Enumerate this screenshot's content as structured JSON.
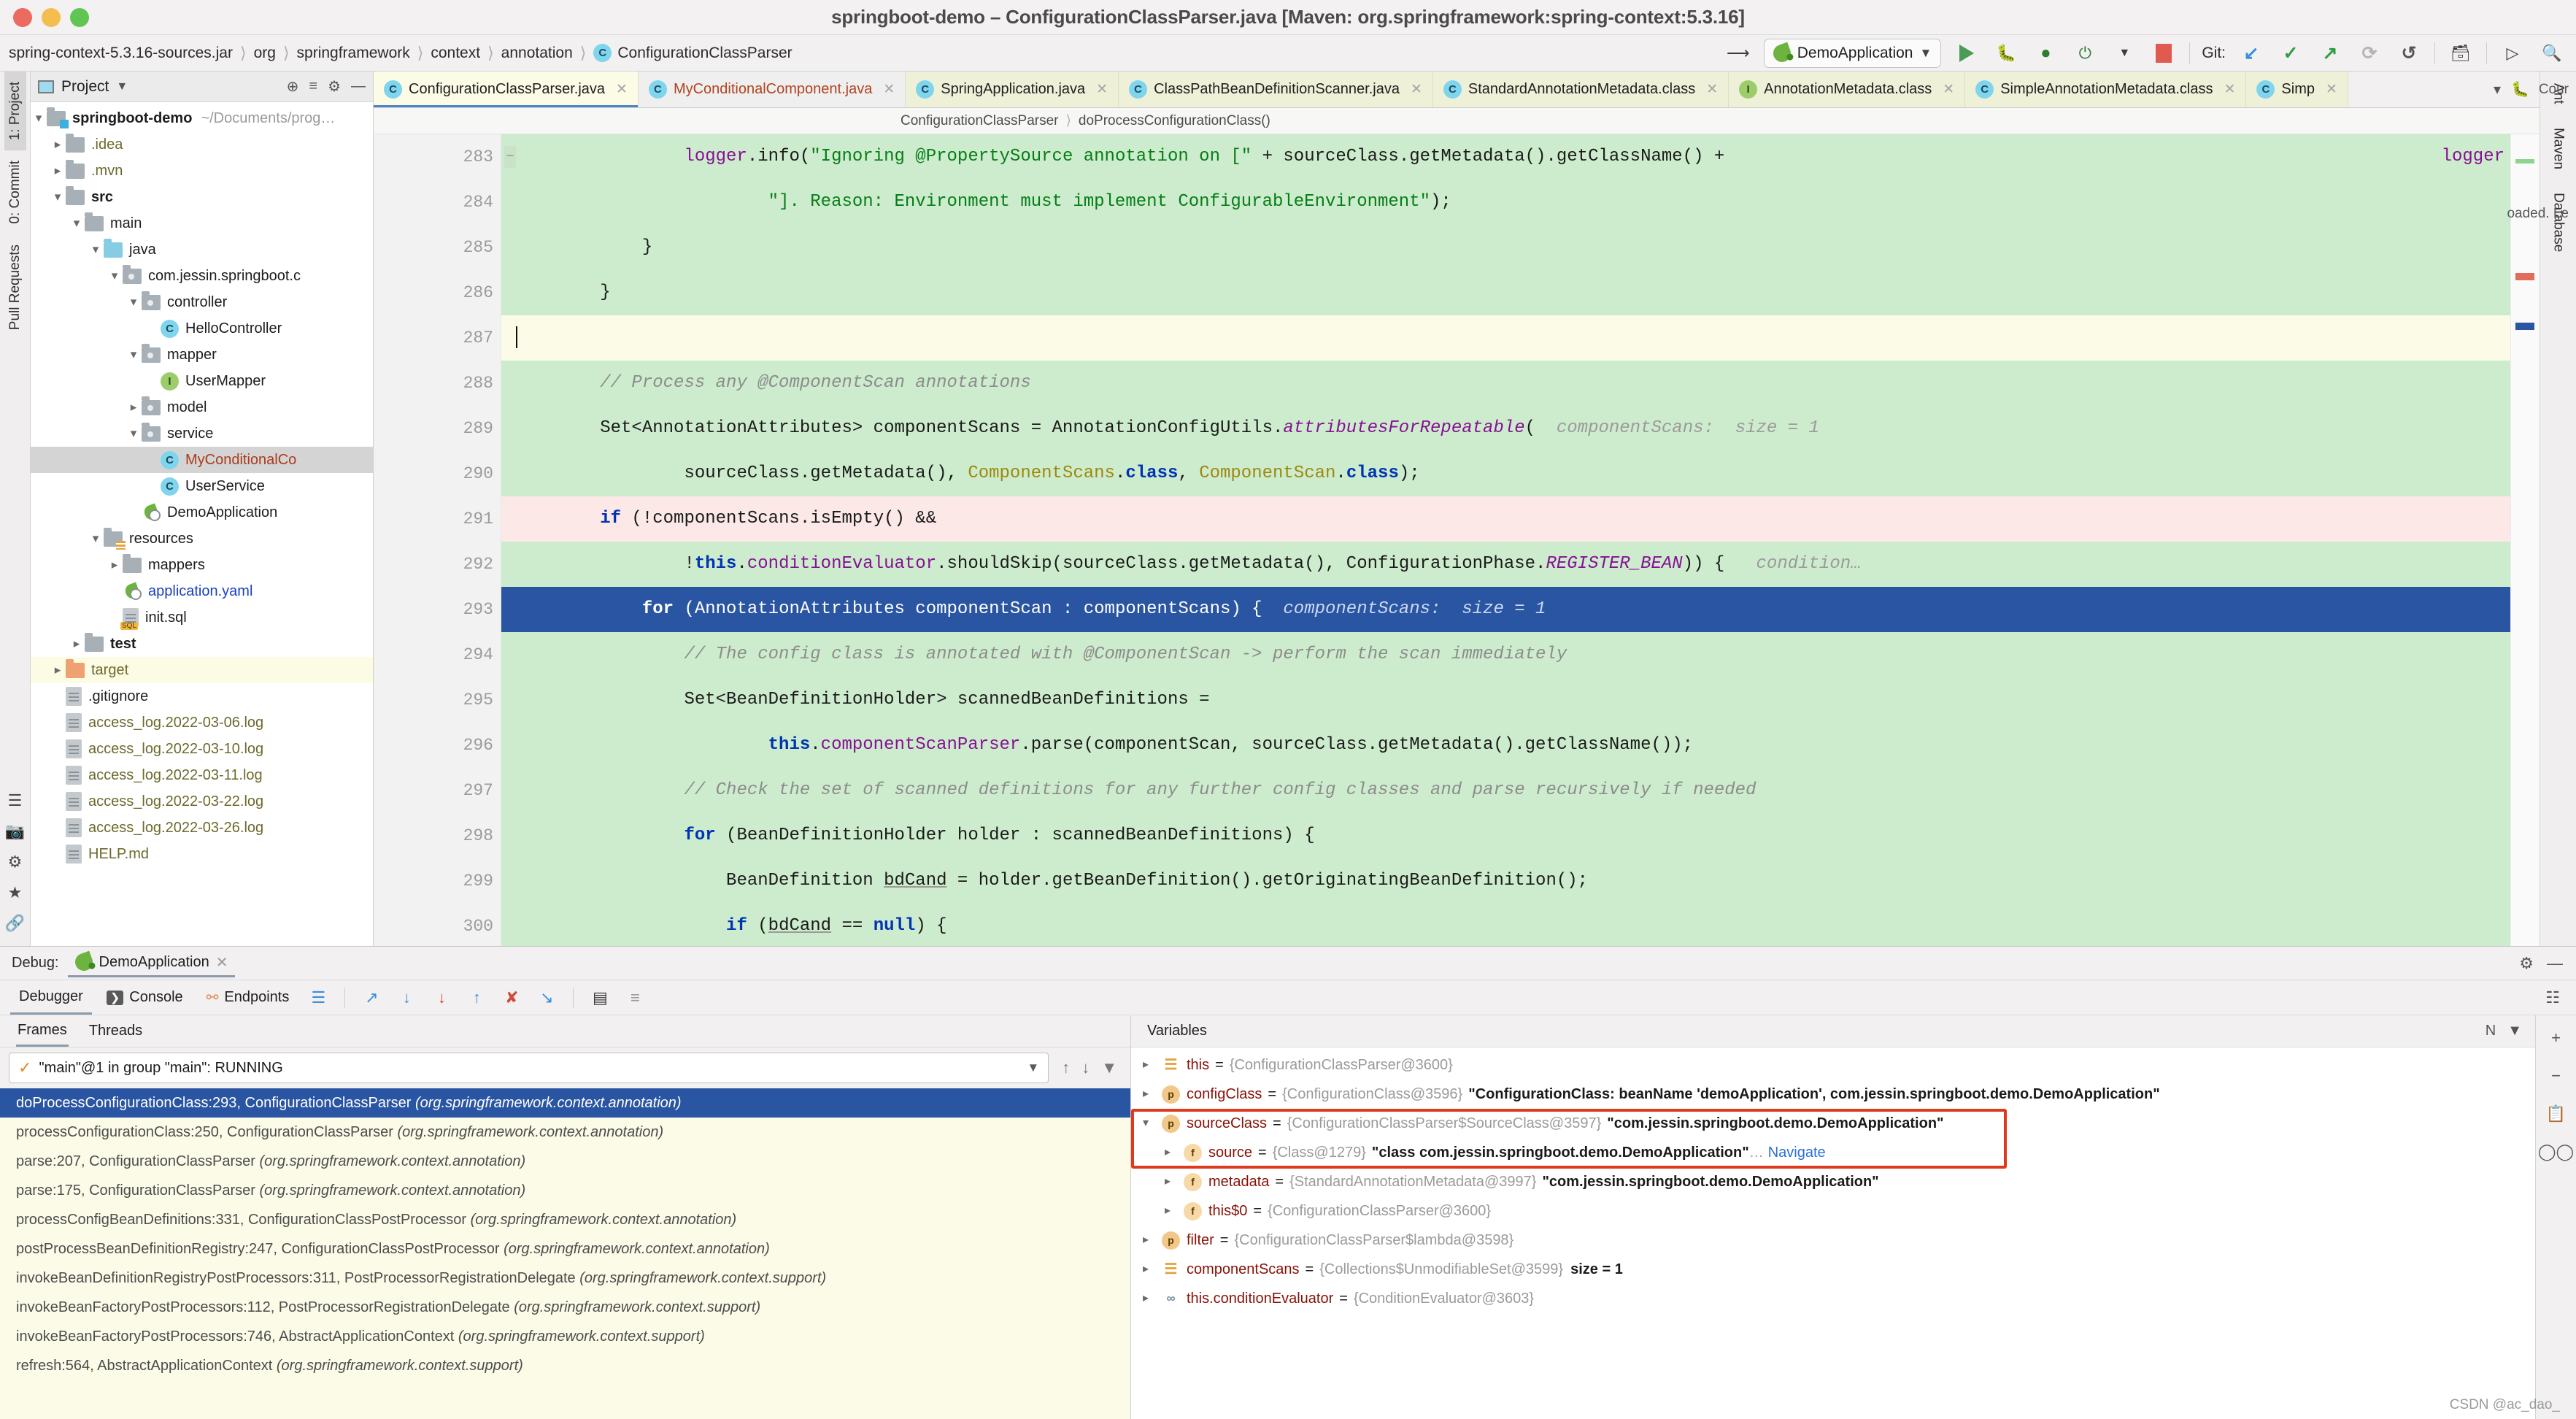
{
  "window": {
    "title": "springboot-demo – ConfigurationClassParser.java [Maven: org.springframework:spring-context:5.3.16]"
  },
  "breadcrumb": {
    "items": [
      "spring-context-5.3.16-sources.jar",
      "org",
      "springframework",
      "context",
      "annotation"
    ],
    "class_icon": "C",
    "class_name": "ConfigurationClassParser"
  },
  "toolbar": {
    "back_icon": "back-arrow-icon",
    "run_config": "DemoApplication",
    "run_icon": "run-icon",
    "debug_icon": "debug-icon",
    "run_coverage_icon": "run-with-coverage-icon",
    "profile_icon": "profile-icon",
    "stop_icon": "stop-icon",
    "git_label": "Git:",
    "git_update": "↙",
    "git_commit": "✓",
    "git_push": "↗",
    "git_history": "⟳",
    "git_rollback": "↺",
    "structure_icon": "project-structure-icon",
    "terminal_icon": "terminal-icon",
    "search_icon": "search-everywhere-icon"
  },
  "left_strip": {
    "tabs": [
      "1: Project",
      "0: Commit",
      "Pull Requests"
    ],
    "bottom": [
      "7: Structure",
      "2: Favorites",
      "Web"
    ]
  },
  "right_strip": {
    "tabs": [
      "Ant",
      "Maven",
      "Database"
    ]
  },
  "project_panel": {
    "title": "Project",
    "locate_icon": "locate-icon",
    "collapse_icon": "collapse-all-icon",
    "settings_icon": "gear-icon",
    "hide_icon": "hide-icon",
    "tree": [
      {
        "depth": 0,
        "arrow": "v",
        "icon": "folder-module",
        "label": "springboot-demo",
        "style": "bold",
        "path": "~/Documents/prog…"
      },
      {
        "depth": 1,
        "arrow": ">",
        "icon": "folder",
        "label": ".idea",
        "style": "olive"
      },
      {
        "depth": 1,
        "arrow": ">",
        "icon": "folder",
        "label": ".mvn",
        "style": "olive"
      },
      {
        "depth": 1,
        "arrow": "v",
        "icon": "folder",
        "label": "src",
        "style": "bold"
      },
      {
        "depth": 2,
        "arrow": "v",
        "icon": "folder",
        "label": "main"
      },
      {
        "depth": 3,
        "arrow": "v",
        "icon": "folder-src",
        "label": "java"
      },
      {
        "depth": 4,
        "arrow": "v",
        "icon": "folder-pkg",
        "label": "com.jessin.springboot.c"
      },
      {
        "depth": 5,
        "arrow": "v",
        "icon": "folder-pkg",
        "label": "controller"
      },
      {
        "depth": 6,
        "arrow": "",
        "icon": "class",
        "label": "HelloController"
      },
      {
        "depth": 5,
        "arrow": "v",
        "icon": "folder-pkg",
        "label": "mapper"
      },
      {
        "depth": 6,
        "arrow": "",
        "icon": "interface",
        "label": "UserMapper"
      },
      {
        "depth": 5,
        "arrow": ">",
        "icon": "folder-pkg",
        "label": "model"
      },
      {
        "depth": 5,
        "arrow": "v",
        "icon": "folder-pkg",
        "label": "service"
      },
      {
        "depth": 6,
        "arrow": "",
        "icon": "class",
        "label": "MyConditionalCo",
        "style": "red",
        "row": "sel"
      },
      {
        "depth": 6,
        "arrow": "",
        "icon": "class",
        "label": "UserService"
      },
      {
        "depth": 5,
        "arrow": "",
        "icon": "spring",
        "label": "DemoApplication"
      },
      {
        "depth": 3,
        "arrow": "v",
        "icon": "folder-res",
        "label": "resources"
      },
      {
        "depth": 4,
        "arrow": ">",
        "icon": "folder",
        "label": "mappers"
      },
      {
        "depth": 4,
        "arrow": "",
        "icon": "spring-yaml",
        "label": "application.yaml",
        "style": "blue"
      },
      {
        "depth": 4,
        "arrow": "",
        "icon": "sql",
        "label": "init.sql"
      },
      {
        "depth": 2,
        "arrow": ">",
        "icon": "folder",
        "label": "test",
        "style": "bold"
      },
      {
        "depth": 1,
        "arrow": ">",
        "icon": "folder-target",
        "label": "target",
        "style": "olive",
        "row": "hl"
      },
      {
        "depth": 1,
        "arrow": "",
        "icon": "gitignore",
        "label": ".gitignore"
      },
      {
        "depth": 1,
        "arrow": "",
        "icon": "doc",
        "label": "access_log.2022-03-06.log",
        "style": "olive"
      },
      {
        "depth": 1,
        "arrow": "",
        "icon": "doc",
        "label": "access_log.2022-03-10.log",
        "style": "olive"
      },
      {
        "depth": 1,
        "arrow": "",
        "icon": "doc",
        "label": "access_log.2022-03-11.log",
        "style": "olive"
      },
      {
        "depth": 1,
        "arrow": "",
        "icon": "doc",
        "label": "access_log.2022-03-22.log",
        "style": "olive"
      },
      {
        "depth": 1,
        "arrow": "",
        "icon": "doc",
        "label": "access_log.2022-03-26.log",
        "style": "olive"
      },
      {
        "depth": 1,
        "arrow": "",
        "icon": "doc",
        "label": "HELP.md",
        "style": "olive"
      }
    ]
  },
  "editor_tabs": [
    {
      "label": "ConfigurationClassParser.java",
      "icon": "C",
      "state": "active"
    },
    {
      "label": "MyConditionalComponent.java",
      "icon": "C",
      "state": "modified",
      "color": "red"
    },
    {
      "label": "SpringApplication.java",
      "icon": "C",
      "state": "normal",
      "spring": true
    },
    {
      "label": "ClassPathBeanDefinitionScanner.java",
      "icon": "C",
      "state": "normal"
    },
    {
      "label": "StandardAnnotationMetadata.class",
      "icon": "C",
      "state": "normal"
    },
    {
      "label": "AnnotationMetadata.class",
      "icon": "I",
      "state": "normal"
    },
    {
      "label": "SimpleAnnotationMetadata.class",
      "icon": "C",
      "state": "normal"
    },
    {
      "label": "Simp",
      "icon": "C",
      "state": "normal"
    }
  ],
  "editor_breadcrumb": {
    "class": "ConfigurationClassParser",
    "sep": "›",
    "method": "doProcessConfigurationClass()"
  },
  "code": {
    "lines": [
      {
        "n": "283",
        "bg": "add",
        "html": "                <span class=\"fld\">logger</span>.info(<span class=\"str\">\"Ignoring @PropertySource annotation on [\"</span> + sourceClass.getMetadata().getClassName() +"
      },
      {
        "n": "284",
        "bg": "add",
        "html": "                        <span class=\"str\">\"]. Reason: Environment must implement ConfigurableEnvironment\"</span>);"
      },
      {
        "n": "285",
        "bg": "add",
        "html": "            }"
      },
      {
        "n": "286",
        "bg": "add",
        "html": "        }"
      },
      {
        "n": "287",
        "bg": "caret",
        "html": "<span class=\"caret-bar\"></span>"
      },
      {
        "n": "288",
        "bg": "add",
        "html": "        <span class=\"cmt\">// Process any @ComponentScan annotations</span>"
      },
      {
        "n": "289",
        "bg": "add",
        "html": "        Set&lt;AnnotationAttributes&gt; componentScans = AnnotationConfigUtils.<span class=\"stat\">attributesForRepeatable</span>(  <span class=\"hint\">componentScans:  size = 1</span>"
      },
      {
        "n": "290",
        "bg": "add",
        "html": "                sourceClass.getMetadata(), <span class=\"ann\">ComponentScans</span>.<span class=\"kw\">class</span>, <span class=\"ann\">ComponentScan</span>.<span class=\"kw\">class</span>);"
      },
      {
        "n": "291",
        "bg": "del",
        "bp": true,
        "html": "        <span class=\"kw\">if</span> (!componentScans.isEmpty() &amp;&amp;"
      },
      {
        "n": "292",
        "bg": "add",
        "fold": true,
        "html": "                !<span class=\"kw\">this</span>.<span class=\"fld\">conditionEvaluator</span>.shouldSkip(sourceClass.getMetadata(), ConfigurationPhase.<span class=\"cst\">REGISTER_BEAN</span>)) {   <span class=\"hint\">condition…</span>"
      },
      {
        "n": "293",
        "bg": "curr",
        "fold": true,
        "html": "            <span class=\"kw\" style=\"color:#fff\">for</span> (AnnotationAttributes componentScan : componentScans) {  <span class=\"hint\">componentScans:  size = 1</span>"
      },
      {
        "n": "294",
        "bg": "add",
        "html": "                <span class=\"cmt\">// The config class is annotated with @ComponentScan -&gt; perform the scan immediately</span>"
      },
      {
        "n": "295",
        "bg": "add",
        "html": "                Set&lt;BeanDefinitionHolder&gt; scannedBeanDefinitions ="
      },
      {
        "n": "296",
        "bg": "add",
        "html": "                        <span class=\"kw\">this</span>.<span class=\"fld\">componentScanParser</span>.parse(componentScan, sourceClass.getMetadata().getClassName());"
      },
      {
        "n": "297",
        "bg": "add",
        "html": "                <span class=\"cmt\">// Check the set of scanned definitions for any further config classes and parse recursively if needed</span>"
      },
      {
        "n": "298",
        "bg": "add",
        "fold": true,
        "html": "                <span class=\"kw\">for</span> (BeanDefinitionHolder holder : scannedBeanDefinitions) {"
      },
      {
        "n": "299",
        "bg": "add",
        "html": "                    BeanDefinition <span class=\"underln\">bdCand</span> = holder.getBeanDefinition().getOriginatingBeanDefinition();"
      },
      {
        "n": "300",
        "bg": "add",
        "fold": true,
        "html": "                    <span class=\"kw\">if</span> (<span class=\"underln\">bdCand</span> == <span class=\"kw\">null</span>) {"
      }
    ],
    "inline_right_hint": "logger"
  },
  "debug": {
    "label": "Debug:",
    "config_name": "DemoApplication",
    "settings_icon": "gear-icon",
    "hide_icon": "hide-icon",
    "tabs": [
      {
        "label": "Debugger",
        "active": true
      },
      {
        "label": "Console",
        "active": false
      },
      {
        "label": "Endpoints",
        "active": false
      }
    ],
    "tools": [
      "mute-breakpoints",
      "step-over",
      "step-into",
      "force-step-into",
      "step-out",
      "drop-frame",
      "run-to-cursor",
      "evaluate-expression",
      "settings"
    ],
    "frames": {
      "tab_frames": "Frames",
      "tab_threads": "Threads",
      "thread": "\"main\"@1 in group \"main\": RUNNING",
      "list": [
        {
          "text": "doProcessConfigurationClass:293, ConfigurationClassParser ",
          "pkg": "(org.springframework.context.annotation)",
          "selected": true
        },
        {
          "text": "processConfigurationClass:250, ConfigurationClassParser ",
          "pkg": "(org.springframework.context.annotation)"
        },
        {
          "text": "parse:207, ConfigurationClassParser ",
          "pkg": "(org.springframework.context.annotation)"
        },
        {
          "text": "parse:175, ConfigurationClassParser ",
          "pkg": "(org.springframework.context.annotation)"
        },
        {
          "text": "processConfigBeanDefinitions:331, ConfigurationClassPostProcessor ",
          "pkg": "(org.springframework.context.annotation)"
        },
        {
          "text": "postProcessBeanDefinitionRegistry:247, ConfigurationClassPostProcessor ",
          "pkg": "(org.springframework.context.annotation)"
        },
        {
          "text": "invokeBeanDefinitionRegistryPostProcessors:311, PostProcessorRegistrationDelegate ",
          "pkg": "(org.springframework.context.support)"
        },
        {
          "text": "invokeBeanFactoryPostProcessors:112, PostProcessorRegistrationDelegate ",
          "pkg": "(org.springframework.context.support)"
        },
        {
          "text": "invokeBeanFactoryPostProcessors:746, AbstractApplicationContext ",
          "pkg": "(org.springframework.context.support)"
        },
        {
          "text": "refresh:564, AbstractApplicationContext ",
          "pkg": "(org.springframework.context.support)"
        }
      ]
    },
    "variables": {
      "header": "Variables",
      "rows": [
        {
          "arrow": ">",
          "badge": "list",
          "name": "this",
          "ref": "{ConfigurationClassParser@3600}",
          "value": "",
          "indent": 0
        },
        {
          "arrow": ">",
          "badge": "p",
          "name": "configClass",
          "ref": "{ConfigurationClass@3596}",
          "value": "\"ConfigurationClass: beanName 'demoApplication', com.jessin.springboot.demo.DemoApplication\"",
          "indent": 0
        },
        {
          "arrow": "v",
          "badge": "p",
          "name": "sourceClass",
          "ref": "{ConfigurationClassParser$SourceClass@3597}",
          "value": "\"com.jessin.springboot.demo.DemoApplication\"",
          "indent": 0,
          "boxed": true
        },
        {
          "arrow": ">",
          "badge": "f",
          "name": "source",
          "ref": "{Class@1279}",
          "value": "\"class com.jessin.springboot.demo.DemoApplication\"",
          "suffix": "…",
          "nav": "Navigate",
          "indent": 1,
          "boxed": true
        },
        {
          "arrow": ">",
          "badge": "f",
          "name": "metadata",
          "ref": "{StandardAnnotationMetadata@3997}",
          "value": "\"com.jessin.springboot.demo.DemoApplication\"",
          "indent": 1
        },
        {
          "arrow": ">",
          "badge": "f",
          "name": "this$0",
          "ref": "{ConfigurationClassParser@3600}",
          "value": "",
          "indent": 1
        },
        {
          "arrow": ">",
          "badge": "p",
          "name": "filter",
          "ref": "{ConfigurationClassParser$lambda@3598}",
          "value": "",
          "indent": 0
        },
        {
          "arrow": ">",
          "badge": "list",
          "name": "componentScans",
          "ref": "{Collections$UnmodifiableSet@3599}",
          "size": "size = 1",
          "value": "",
          "indent": 0
        },
        {
          "arrow": ">",
          "badge": "oo",
          "name": "this.conditionEvaluator",
          "ref": "{ConditionEvaluator@3603}",
          "value": "",
          "indent": 0
        }
      ]
    },
    "side_icons": [
      "add-watch",
      "remove-watch",
      "copy-value",
      "inspect",
      "watches"
    ],
    "right_hints": [
      "Cour",
      "oaded. Le",
      "N"
    ]
  },
  "watermark": "CSDN @ac_dao_"
}
